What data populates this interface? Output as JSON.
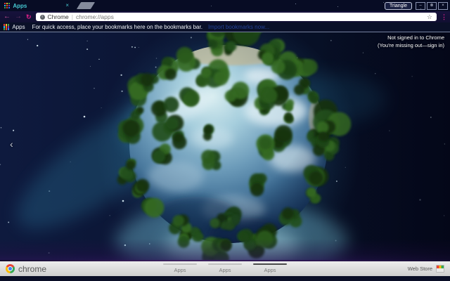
{
  "window": {
    "profile_badge": "Triangle",
    "controls": {
      "minimize_glyph": "–",
      "restore_glyph": "⊗",
      "close_glyph": "×"
    }
  },
  "tab_strip": {
    "tab_label": "Apps",
    "close_glyph": "×"
  },
  "toolbar": {
    "back_glyph": "←",
    "forward_glyph": "→",
    "reload_glyph": "↻",
    "url_chip": "Chrome",
    "url_separator": "|",
    "url": "chrome://apps",
    "star_glyph": "☆",
    "menu_glyph": "⋮"
  },
  "bookmarks_bar": {
    "apps_label": "Apps",
    "message": "For quick access, place your bookmarks here on the bookmarks bar.",
    "import_link": "Import bookmarks now..."
  },
  "content": {
    "signin_line1": "Not signed in to Chrome",
    "signin_line2": "(You're missing out—sign in)",
    "page_back_glyph": "‹"
  },
  "launcher_bar": {
    "brand": "chrome",
    "pages": [
      {
        "label": "Apps"
      },
      {
        "label": "Apps"
      },
      {
        "label": "Apps"
      }
    ],
    "active_page_index": 2,
    "web_store_label": "Web Store"
  },
  "colors": {
    "accent_pink": "#e0218a",
    "tab_cyan": "#46c8d2",
    "frame_navy": "#070c24",
    "toolbar_navy": "#120f33",
    "bookmarks_navy": "#0a1028",
    "launcher_gray": "#dcdcdc"
  }
}
